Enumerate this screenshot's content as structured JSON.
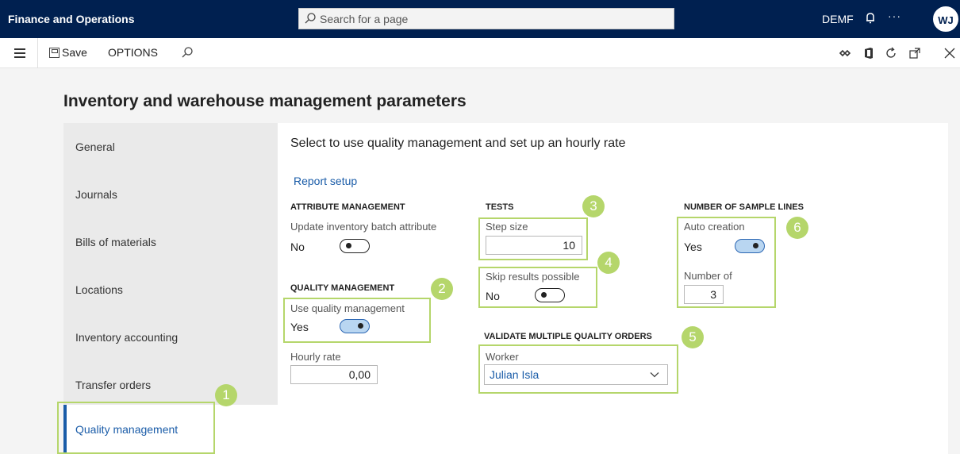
{
  "app": {
    "title": "Finance and Operations",
    "company": "DEMF",
    "avatar_initials": "WJ",
    "ellipsis": "···"
  },
  "search": {
    "placeholder": "Search for a page"
  },
  "toolbar": {
    "save_label": "Save",
    "options_label": "OPTIONS"
  },
  "page": {
    "title": "Inventory and warehouse management parameters",
    "content_title": "Select to use quality management and set up an hourly rate",
    "report_link": "Report setup"
  },
  "sidebar": {
    "items": [
      {
        "label": "General"
      },
      {
        "label": "Journals"
      },
      {
        "label": "Bills of materials"
      },
      {
        "label": "Locations"
      },
      {
        "label": "Inventory accounting"
      },
      {
        "label": "Transfer orders"
      },
      {
        "label": "Quality management",
        "active": true
      }
    ]
  },
  "attribute_management": {
    "header": "ATTRIBUTE MANAGEMENT",
    "update_label": "Update inventory batch attribute",
    "update_value": "No",
    "update_on": false
  },
  "quality_management": {
    "header": "QUALITY MANAGEMENT",
    "use_label": "Use quality management",
    "use_value": "Yes",
    "use_on": true,
    "hourly_rate_label": "Hourly rate",
    "hourly_rate_value": "0,00"
  },
  "tests": {
    "header": "TESTS",
    "step_size_label": "Step size",
    "step_size_value": "10",
    "skip_label": "Skip results possible",
    "skip_value": "No",
    "skip_on": false
  },
  "validate": {
    "header": "VALIDATE MULTIPLE QUALITY ORDERS",
    "worker_label": "Worker",
    "worker_value": "Julian Isla"
  },
  "sample_lines": {
    "header": "NUMBER OF SAMPLE LINES",
    "auto_label": "Auto creation",
    "auto_value": "Yes",
    "auto_on": true,
    "number_label": "Number of",
    "number_value": "3"
  },
  "callouts": [
    "1",
    "2",
    "3",
    "4",
    "5",
    "6"
  ],
  "colors": {
    "navy": "#002050",
    "accent": "#1a5ca8",
    "callout": "#b5d66b"
  },
  "icons": [
    "search-icon",
    "bell-icon",
    "hamburger-icon",
    "save-icon",
    "diamond-link-icon",
    "office-icon",
    "refresh-icon",
    "popout-icon",
    "close-icon",
    "chevron-down-icon"
  ]
}
